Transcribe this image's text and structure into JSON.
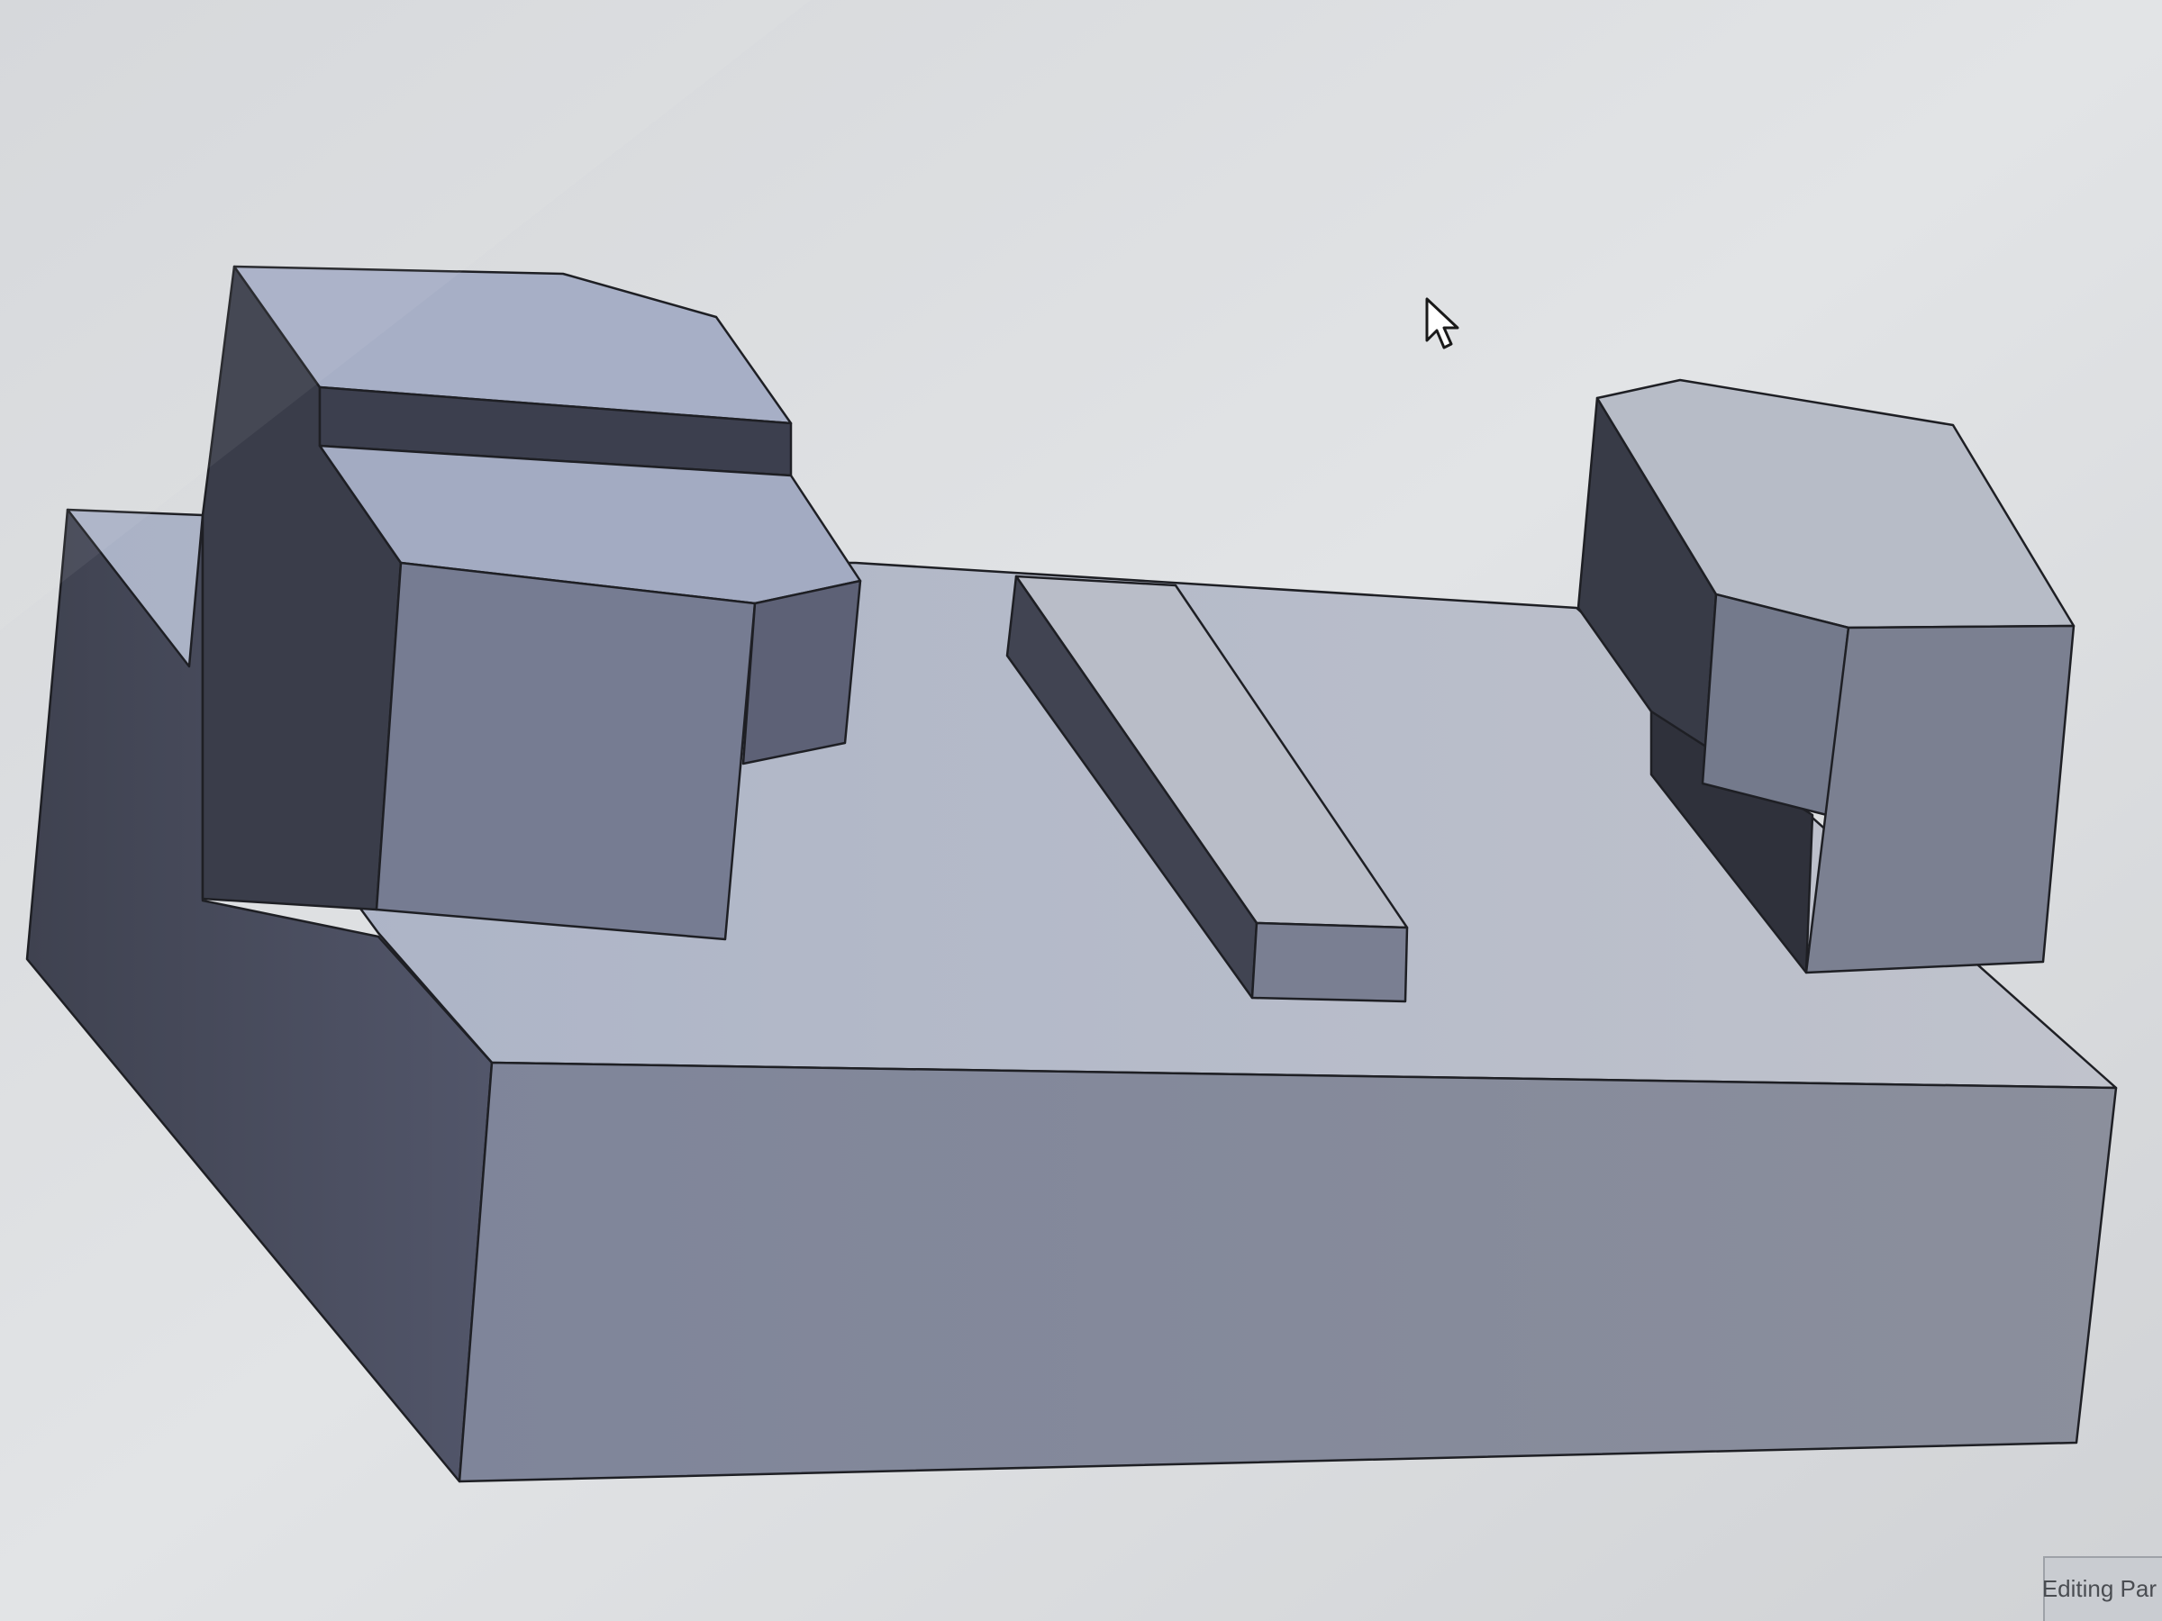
{
  "statusbar": {
    "text": "Editing Par"
  },
  "colors": {
    "background": "#d9dbde",
    "top_face": "#b3bac8",
    "front_face": "#8a90a1",
    "side_face": "#4d5160",
    "dark_face": "#3a3d48",
    "edge": "#1e1f24"
  },
  "icons": {
    "cursor": "arrow-pointer-icon"
  }
}
